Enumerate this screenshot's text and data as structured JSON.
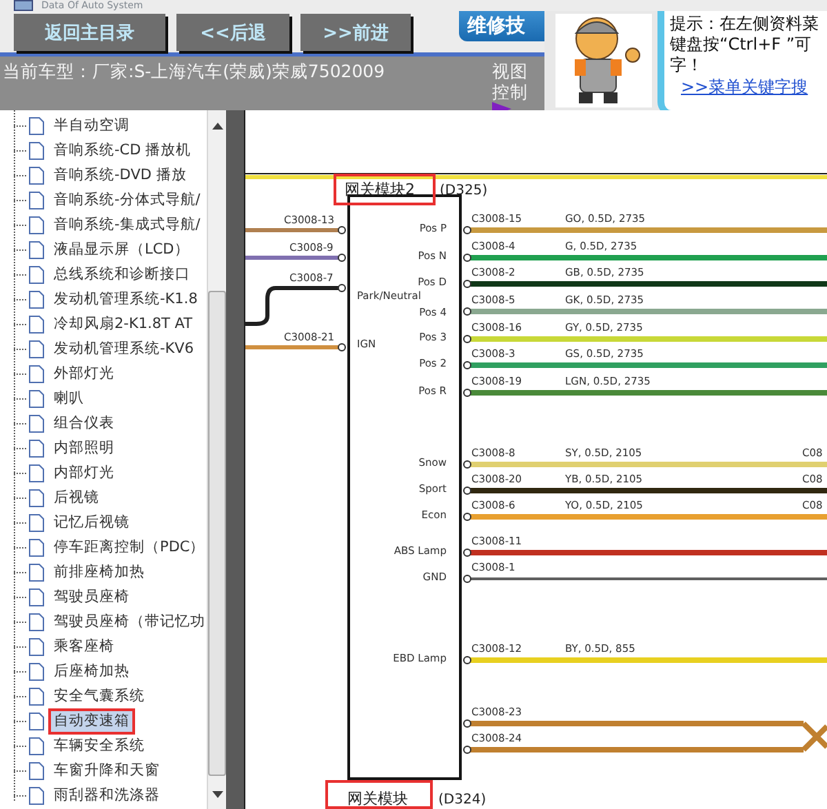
{
  "window": {
    "title": "Data Of Auto System"
  },
  "toolbar": {
    "buttons": [
      "返回主目录",
      "<<后退",
      ">>前进"
    ],
    "banner": "维修技"
  },
  "car_model": "当前车型：厂家:S-上海汽车(荣威)荣威7502009",
  "view_control": {
    "label": "视图控制",
    "expanded": false
  },
  "tip": {
    "lines": [
      "提示：在左侧资料菜",
      "键盘按“Ctrl+F ”可",
      "字！"
    ],
    "link": ">>菜单关键字搜"
  },
  "tree": {
    "items": [
      {
        "label": "半自动空调",
        "selected": false,
        "marked": false
      },
      {
        "label": "音响系统-CD 播放机",
        "selected": false,
        "marked": false
      },
      {
        "label": "音响系统-DVD 播放",
        "selected": false,
        "marked": false
      },
      {
        "label": "音响系统-分体式导航/",
        "selected": false,
        "marked": false
      },
      {
        "label": "音响系统-集成式导航/",
        "selected": false,
        "marked": false
      },
      {
        "label": "液晶显示屏（LCD）",
        "selected": false,
        "marked": false
      },
      {
        "label": "总线系统和诊断接口",
        "selected": false,
        "marked": false
      },
      {
        "label": "发动机管理系统-K1.8",
        "selected": false,
        "marked": false
      },
      {
        "label": "冷却风扇2-K1.8T AT",
        "selected": false,
        "marked": false
      },
      {
        "label": "发动机管理系统-KV6",
        "selected": false,
        "marked": false
      },
      {
        "label": "外部灯光",
        "selected": false,
        "marked": false
      },
      {
        "label": "喇叭",
        "selected": false,
        "marked": false
      },
      {
        "label": "组合仪表",
        "selected": false,
        "marked": false
      },
      {
        "label": "内部照明",
        "selected": false,
        "marked": false
      },
      {
        "label": "内部灯光",
        "selected": false,
        "marked": false
      },
      {
        "label": "后视镜",
        "selected": false,
        "marked": false
      },
      {
        "label": "记忆后视镜",
        "selected": false,
        "marked": false
      },
      {
        "label": "停车距离控制（PDC）",
        "selected": false,
        "marked": false
      },
      {
        "label": "前排座椅加热",
        "selected": false,
        "marked": false
      },
      {
        "label": "驾驶员座椅",
        "selected": false,
        "marked": false
      },
      {
        "label": "驾驶员座椅（带记忆功",
        "selected": false,
        "marked": false
      },
      {
        "label": "乘客座椅",
        "selected": false,
        "marked": false
      },
      {
        "label": "后座椅加热",
        "selected": false,
        "marked": false
      },
      {
        "label": "安全气囊系统",
        "selected": false,
        "marked": false
      },
      {
        "label": "自动变速箱",
        "selected": true,
        "marked": true
      },
      {
        "label": "车辆安全系统",
        "selected": false,
        "marked": false
      },
      {
        "label": "车窗升降和天窗",
        "selected": false,
        "marked": false
      },
      {
        "label": "雨刮器和洗涤器",
        "selected": false,
        "marked": false
      }
    ]
  },
  "diagram": {
    "top_module": {
      "name": "网关模块2",
      "code": "(D325)",
      "marked": true
    },
    "bottom_module": {
      "name": "网关模块",
      "code": "(D324)",
      "marked": true
    },
    "left_wires": [
      {
        "connector": "C3008-13",
        "color": "#b08050"
      },
      {
        "connector": "C3008-9",
        "color": "#8070b0"
      },
      {
        "connector": "C3008-7",
        "color": "#202020"
      },
      {
        "connector": "C3008-21",
        "color": "#d09040"
      }
    ],
    "side_pins": [
      "Park/Neutral",
      "IGN"
    ],
    "wires": [
      {
        "pin": "Pos P",
        "connector": "C3008-15",
        "spec": "GO, 0.5D, 2735",
        "color": "#c89a40"
      },
      {
        "pin": "Pos N",
        "connector": "C3008-4",
        "spec": "G, 0.5D, 2735",
        "color": "#20a050"
      },
      {
        "pin": "Pos D",
        "connector": "C3008-2",
        "spec": "GB, 0.5D, 2735",
        "color": "#103818"
      },
      {
        "pin": "Pos 4",
        "connector": "C3008-5",
        "spec": "GK, 0.5D, 2735",
        "color": "#8aa890"
      },
      {
        "pin": "Pos 3",
        "connector": "C3008-16",
        "spec": "GY, 0.5D, 2735",
        "color": "#c8d838"
      },
      {
        "pin": "Pos 2",
        "connector": "C3008-3",
        "spec": "GS, 0.5D, 2735",
        "color": "#30a060"
      },
      {
        "pin": "Pos R",
        "connector": "C3008-19",
        "spec": "LGN, 0.5D, 2735",
        "color": "#4a8a3a"
      },
      {
        "pin": "Snow",
        "connector": "C3008-8",
        "spec": "SY, 0.5D, 2105",
        "far_connector": "C08",
        "color": "#e0d070"
      },
      {
        "pin": "Sport",
        "connector": "C3008-20",
        "spec": "YB, 0.5D, 2105",
        "far_connector": "C08",
        "color": "#302810"
      },
      {
        "pin": "Econ",
        "connector": "C3008-6",
        "spec": "YO, 0.5D, 2105",
        "far_connector": "C08",
        "color": "#e8a030"
      },
      {
        "pin": "ABS Lamp",
        "connector": "C3008-11",
        "color": "#c03020"
      },
      {
        "pin": "GND",
        "connector": "C3008-1",
        "color": "#606060"
      },
      {
        "pin": "EBD Lamp",
        "connector": "C3008-12",
        "spec": "BY, 0.5D, 855",
        "color": "#e8d020"
      },
      {
        "connector": "C3008-23",
        "color": "#c08030"
      },
      {
        "connector": "C3008-24",
        "color": "#c08030"
      }
    ]
  }
}
